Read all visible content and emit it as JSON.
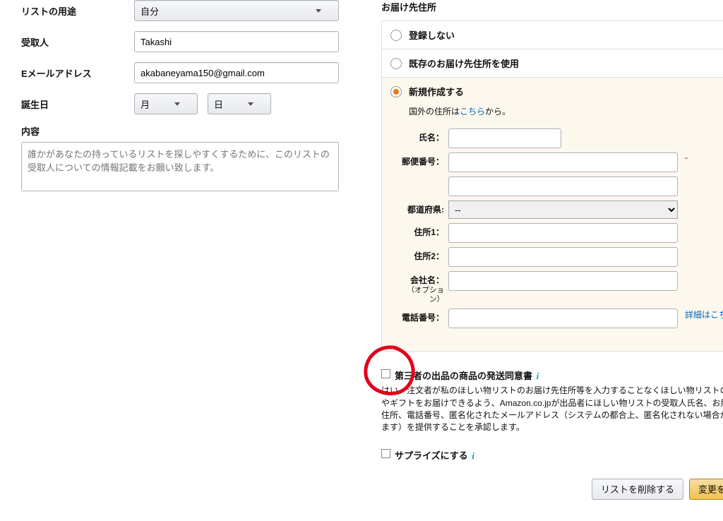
{
  "left": {
    "purpose_label": "リストの用途",
    "purpose_value": "自分",
    "recipient_label": "受取人",
    "recipient_value": "Takashi",
    "email_label": "Eメールアドレス",
    "email_value": "akabaneyama150@gmail.com",
    "birthday_label": "誕生日",
    "month_value": "月",
    "day_value": "日",
    "content_label": "内容",
    "content_placeholder": "誰かがあなたの持っているリストを探しやすくするために、このリストの受取人についての情報記載をお願い致します。"
  },
  "right": {
    "address_section_title": "お届け先住所",
    "radio_none": "登録しない",
    "radio_existing": "既存のお届け先住所を使用",
    "radio_new": "新規作成する",
    "overseas_prefix": "国外の住所は",
    "overseas_link": "こちら",
    "overseas_suffix": "から。",
    "fields": {
      "name": "氏名：",
      "postal": "郵便番号：",
      "postal_dash": "-",
      "pref": "都道府県:",
      "pref_value": "--",
      "addr1": "住所1：",
      "addr2": "住所2：",
      "company": "会社名：",
      "company_opt": "（オプション）",
      "phone": "電話番号：",
      "phone_link": "詳細はこちら"
    },
    "consent_title": "第三者の出品の商品の発送同意書",
    "consent_body": "はい、注文者が私のほしい物リストのお届け先住所等を入力することなくほしい物リストの商品やギフトをお届けできるよう、Amazon.co.jpが出品者にほしい物リストの受取人氏名、お届け先住所、電話番号、匿名化されたメールアドレス（システムの都合上、匿名化されない場合があります）を提供することを承認します。",
    "surprise_label": "サプライズにする",
    "btn_delete": "リストを削除する",
    "btn_save": "変更を保存"
  }
}
